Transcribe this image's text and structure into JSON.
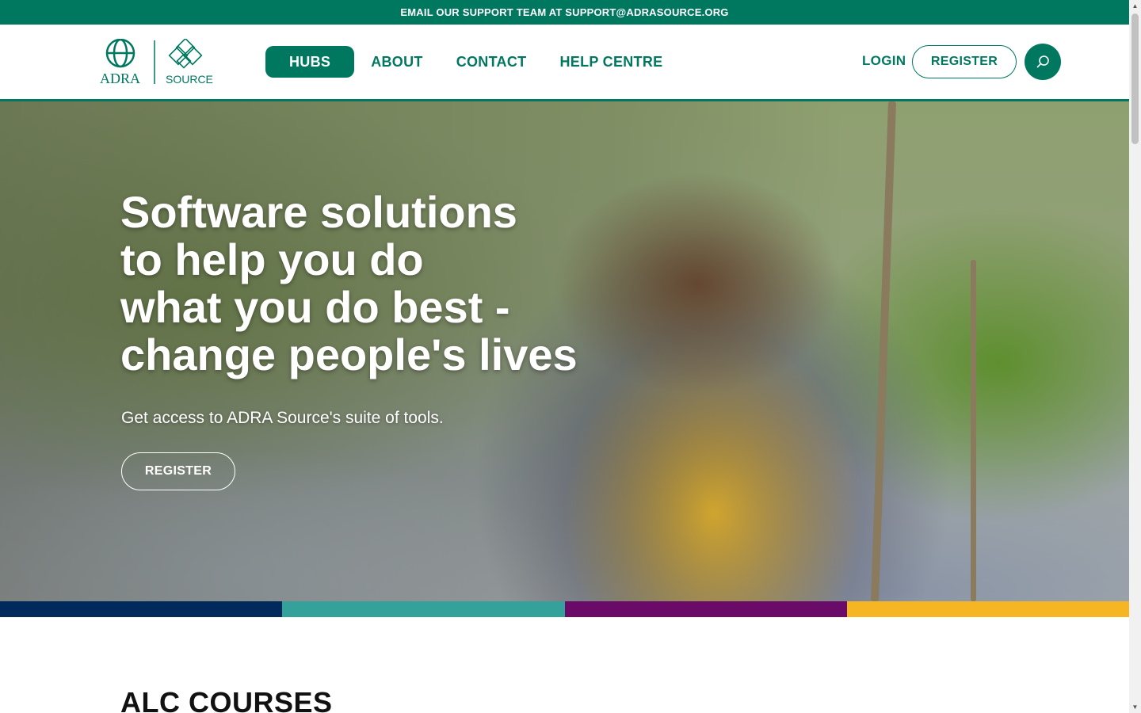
{
  "topbar": {
    "text": "EMAIL OUR SUPPORT TEAM AT SUPPORT@ADRASOURCE.ORG"
  },
  "logo": {
    "primary": "ADRA",
    "secondary": "SOURCE"
  },
  "nav": {
    "items": [
      {
        "label": "HUBS",
        "active": true
      },
      {
        "label": "ABOUT",
        "active": false
      },
      {
        "label": "CONTACT",
        "active": false
      },
      {
        "label": "HELP CENTRE",
        "active": false
      }
    ]
  },
  "header_actions": {
    "login_label": "LOGIN",
    "register_label": "REGISTER",
    "search_icon": "search-icon"
  },
  "hero": {
    "title": "Software solutions\nto help you do\nwhat you do best -\nchange people's lives",
    "subtitle": "Get access to ADRA Source's suite of tools.",
    "register_label": "REGISTER"
  },
  "color_strip": [
    "#002a5c",
    "#35a19b",
    "#6a0b6a",
    "#f6b623"
  ],
  "colors": {
    "brand": "#007860"
  },
  "section": {
    "title": "ALC COURSES"
  }
}
